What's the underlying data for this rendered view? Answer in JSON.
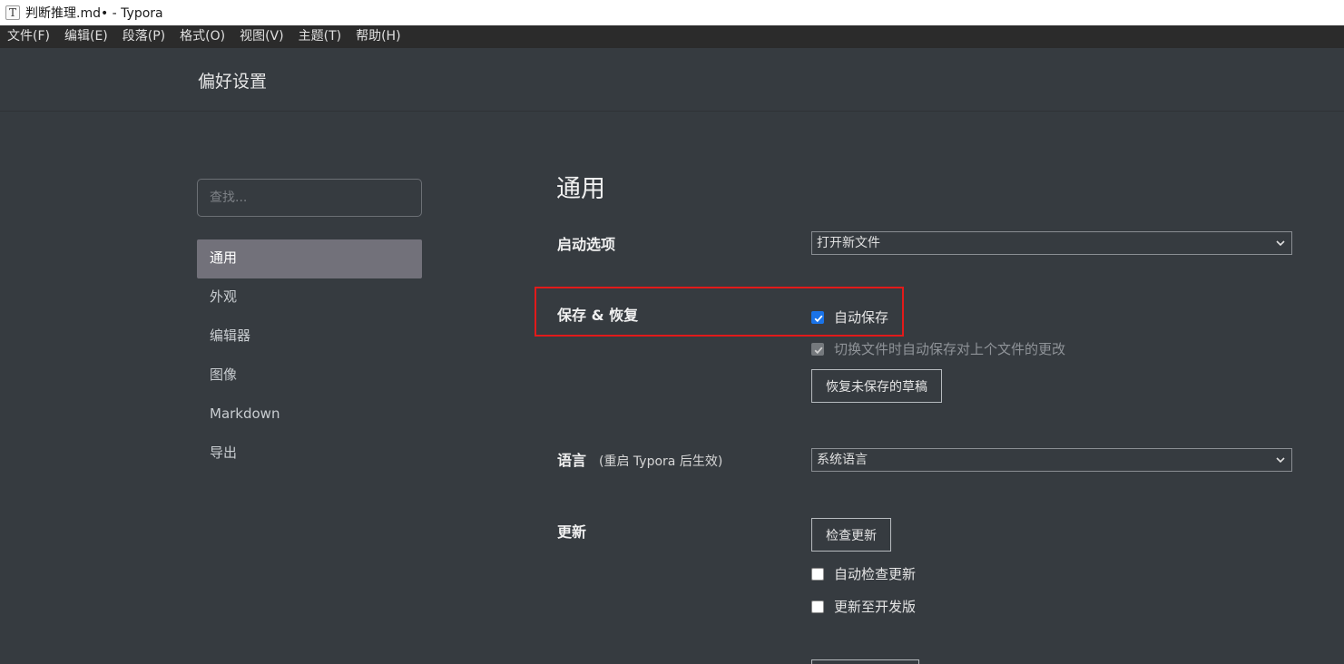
{
  "window": {
    "title": "判断推理.md• - Typora",
    "icon_letter": "T"
  },
  "menu": [
    "文件(F)",
    "编辑(E)",
    "段落(P)",
    "格式(O)",
    "视图(V)",
    "主题(T)",
    "帮助(H)"
  ],
  "prefs": {
    "header_title": "偏好设置"
  },
  "search": {
    "placeholder": "查找..."
  },
  "nav": {
    "items": [
      "通用",
      "外观",
      "编辑器",
      "图像",
      "Markdown",
      "导出"
    ],
    "active_index": 0
  },
  "general": {
    "section_title": "通用",
    "startup": {
      "label": "启动选项",
      "value": "打开新文件"
    },
    "save": {
      "label": "保存 & 恢复",
      "autosave_label": "自动保存",
      "autosave_checked": true,
      "switch_label": "切换文件时自动保存对上个文件的更改",
      "switch_checked": true,
      "switch_disabled": true,
      "recover_button": "恢复未保存的草稿"
    },
    "language": {
      "label": "语言",
      "note": "(重启 Typora 后生效)",
      "value": "系统语言"
    },
    "update": {
      "label": "更新",
      "check_button": "检查更新",
      "auto_check_label": "自动检查更新",
      "auto_check_checked": false,
      "dev_label": "更新至开发版",
      "dev_checked": false
    }
  },
  "colors": {
    "background": "#363b40",
    "menubar": "#2b2b2b",
    "active_nav": "#72717a",
    "checkbox_accent": "#1a73e8",
    "highlight_box": "#e21a1a"
  }
}
